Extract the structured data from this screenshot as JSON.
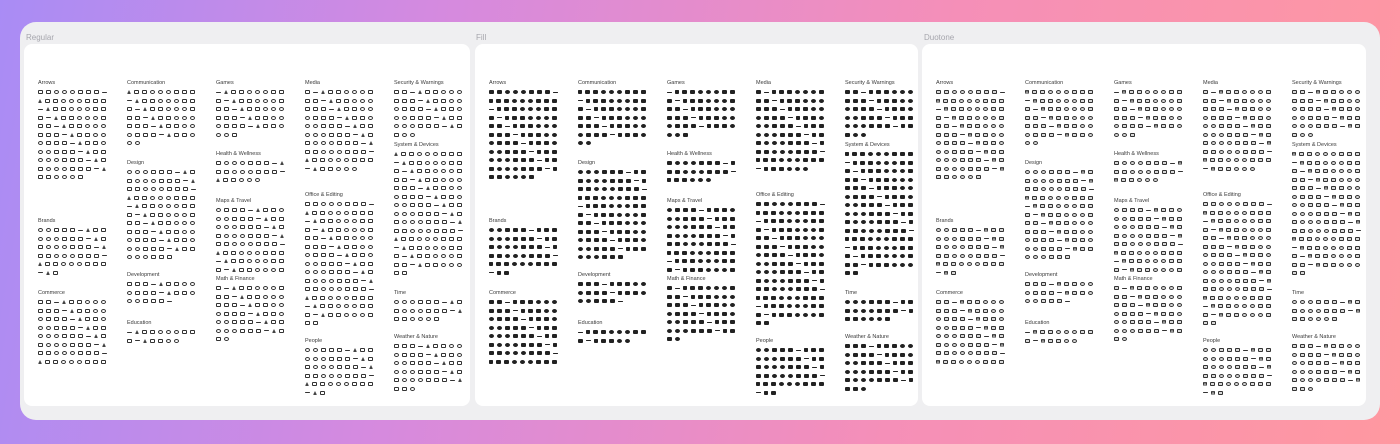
{
  "frames": {
    "regular": "Regular",
    "fill": "Fill",
    "duotone": "Duotone"
  },
  "regular": {
    "columns": [
      [
        {
          "name": "Arrows",
          "rows": 12
        },
        {
          "name": "Brands",
          "rows": 6
        },
        {
          "name": "Commerce",
          "rows": 9
        }
      ],
      [
        {
          "name": "Communication",
          "rows": 7
        },
        {
          "name": "Design",
          "rows": 12
        },
        {
          "name": "Development",
          "rows": 3
        },
        {
          "name": "Education",
          "rows": 2
        }
      ],
      [
        {
          "name": "Games",
          "rows": 6
        },
        {
          "name": "Health & Wellness",
          "rows": 3
        },
        {
          "name": "Maps & Travel",
          "rows": 9
        },
        {
          "name": "Math & Finance",
          "rows": 7
        }
      ],
      [
        {
          "name": "Media",
          "rows": 11
        },
        {
          "name": "Office & Editing",
          "rows": 16
        },
        {
          "name": "People",
          "rows": 6
        }
      ],
      [
        {
          "name": "Security & Warnings",
          "rows": 6
        },
        {
          "name": "System & Devices",
          "rows": 16
        },
        {
          "name": "Time",
          "rows": 3
        },
        {
          "name": "Weather & Nature",
          "rows": 6
        }
      ]
    ],
    "tops": [
      [
        44,
        182,
        254
      ],
      [
        44,
        124,
        236,
        284
      ],
      [
        44,
        115,
        162,
        240
      ],
      [
        44,
        156,
        302
      ],
      [
        44,
        106,
        254,
        298
      ]
    ]
  },
  "fill": {
    "columns": [
      [
        {
          "name": "Arrows",
          "rows": 12
        },
        {
          "name": "Brands",
          "rows": 6
        },
        {
          "name": "Commerce",
          "rows": 9
        }
      ],
      [
        {
          "name": "Communication",
          "rows": 7
        },
        {
          "name": "Design",
          "rows": 12
        },
        {
          "name": "Development",
          "rows": 3
        },
        {
          "name": "Education",
          "rows": 2
        }
      ],
      [
        {
          "name": "Games",
          "rows": 6
        },
        {
          "name": "Health & Wellness",
          "rows": 3
        },
        {
          "name": "Maps & Travel",
          "rows": 9
        },
        {
          "name": "Math & Finance",
          "rows": 7
        }
      ],
      [
        {
          "name": "Media",
          "rows": 11
        },
        {
          "name": "Office & Editing",
          "rows": 16
        },
        {
          "name": "People",
          "rows": 6
        }
      ],
      [
        {
          "name": "Security & Warnings",
          "rows": 6
        },
        {
          "name": "System & Devices",
          "rows": 16
        },
        {
          "name": "Time",
          "rows": 3
        },
        {
          "name": "Weather & Nature",
          "rows": 6
        }
      ]
    ],
    "tops": [
      [
        44,
        182,
        254
      ],
      [
        44,
        124,
        236,
        284
      ],
      [
        44,
        115,
        162,
        240
      ],
      [
        44,
        156,
        302
      ],
      [
        44,
        106,
        254,
        298
      ]
    ]
  },
  "duotone": {
    "columns": [
      [
        {
          "name": "Arrows",
          "rows": 12
        },
        {
          "name": "Brands",
          "rows": 6
        },
        {
          "name": "Commerce",
          "rows": 9
        }
      ],
      [
        {
          "name": "Communication",
          "rows": 7
        },
        {
          "name": "Design",
          "rows": 12
        },
        {
          "name": "Development",
          "rows": 3
        },
        {
          "name": "Education",
          "rows": 2
        }
      ],
      [
        {
          "name": "Games",
          "rows": 6
        },
        {
          "name": "Health & Wellness",
          "rows": 3
        },
        {
          "name": "Maps & Travel",
          "rows": 9
        },
        {
          "name": "Math & Finance",
          "rows": 7
        }
      ],
      [
        {
          "name": "Media",
          "rows": 11
        },
        {
          "name": "Office & Editing",
          "rows": 16
        },
        {
          "name": "People",
          "rows": 6
        }
      ],
      [
        {
          "name": "Security & Warnings",
          "rows": 6
        },
        {
          "name": "System & Devices",
          "rows": 16
        },
        {
          "name": "Time",
          "rows": 3
        },
        {
          "name": "Weather & Nature",
          "rows": 6
        }
      ]
    ],
    "tops": [
      [
        44,
        182,
        254
      ],
      [
        44,
        124,
        236,
        284
      ],
      [
        44,
        115,
        162,
        240
      ],
      [
        44,
        156,
        302
      ],
      [
        44,
        106,
        254,
        298
      ]
    ]
  }
}
